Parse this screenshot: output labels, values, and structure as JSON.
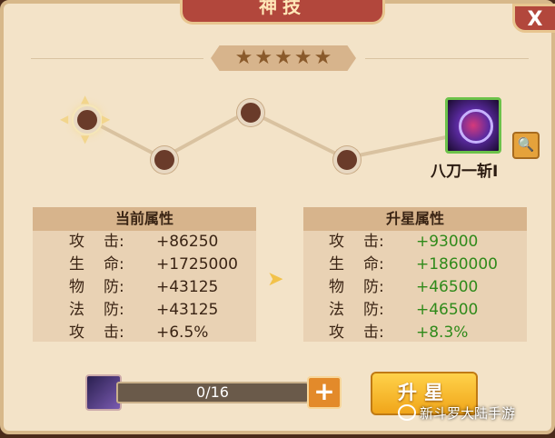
{
  "window": {
    "title": "神技",
    "close_label": "X"
  },
  "stars": {
    "count": 5,
    "glyph": "★"
  },
  "skill": {
    "name": "八刀一斩I",
    "magnify_icon": "search-icon"
  },
  "current": {
    "header": "当前属性",
    "rows": [
      {
        "a": "攻",
        "b": "击:",
        "value": "+86250"
      },
      {
        "a": "生",
        "b": "命:",
        "value": "+1725000"
      },
      {
        "a": "物",
        "b": "防:",
        "value": "+43125"
      },
      {
        "a": "法",
        "b": "防:",
        "value": "+43125"
      },
      {
        "a": "攻",
        "b": "击:",
        "value": "+6.5%"
      }
    ]
  },
  "upgrade": {
    "header": "升星属性",
    "rows": [
      {
        "a": "攻",
        "b": "击:",
        "value": "+93000"
      },
      {
        "a": "生",
        "b": "命:",
        "value": "+1860000"
      },
      {
        "a": "物",
        "b": "防:",
        "value": "+46500"
      },
      {
        "a": "法",
        "b": "防:",
        "value": "+46500"
      },
      {
        "a": "攻",
        "b": "击:",
        "value": "+8.3%"
      }
    ]
  },
  "progress": {
    "text": "0/16"
  },
  "buttons": {
    "plus": "+",
    "upgrade": "升星"
  },
  "watermark": {
    "text": "新斗罗大陆手游"
  },
  "colors": {
    "accent_red": "#b2473c",
    "green_value": "#2f8a1a",
    "button_gold": "#f0a51a"
  }
}
